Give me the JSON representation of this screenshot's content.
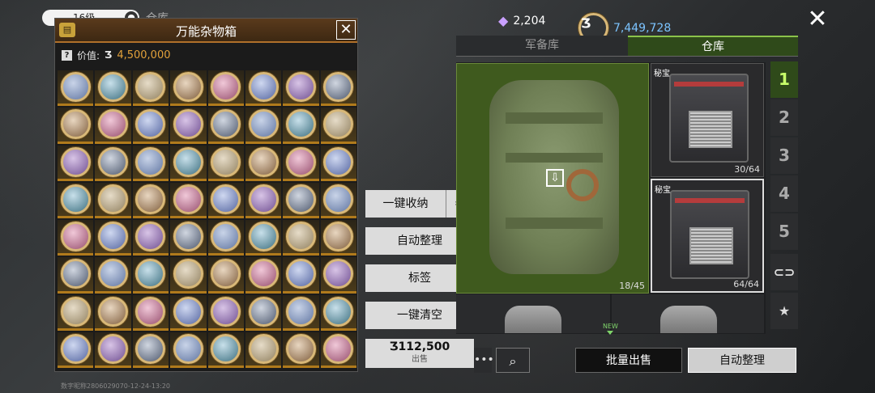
{
  "top": {
    "pill_text": "16级",
    "pill_icon": "info-icon",
    "label": "仓库"
  },
  "currency": {
    "gems": "2,204",
    "coins": "7,449,728",
    "coin_symbol": "Ʒ"
  },
  "modal": {
    "title": "万能杂物箱",
    "value_label": "价值:",
    "value_symbol": "Ʒ",
    "value": "4,500,000",
    "item_count": 64
  },
  "actions": {
    "store_all": "一键收纳",
    "auto_sort": "自动整理",
    "tag": "标签",
    "clear_all": "一键清空",
    "price": "Ʒ112,500",
    "sell": "出售"
  },
  "tabs": {
    "armory": "军备库",
    "warehouse": "仓库"
  },
  "storage": {
    "backpack_count": "18/45",
    "chest1_tag": "秘宝",
    "chest1_count": "30/64",
    "chest2_tag": "秘宝",
    "chest2_count": "64/64",
    "new_tag": "NEW"
  },
  "pages": [
    "1",
    "2",
    "3",
    "4",
    "5"
  ],
  "bottom": {
    "more": "•••",
    "batch_sell": "批量出售",
    "auto_sort": "自动整理"
  },
  "watermark": "数字昵称2806029070-12-24-13:20",
  "colors": {
    "accent_green": "#8bc34a",
    "gold": "#e3a13a",
    "coin_blue": "#7cc4ff"
  }
}
